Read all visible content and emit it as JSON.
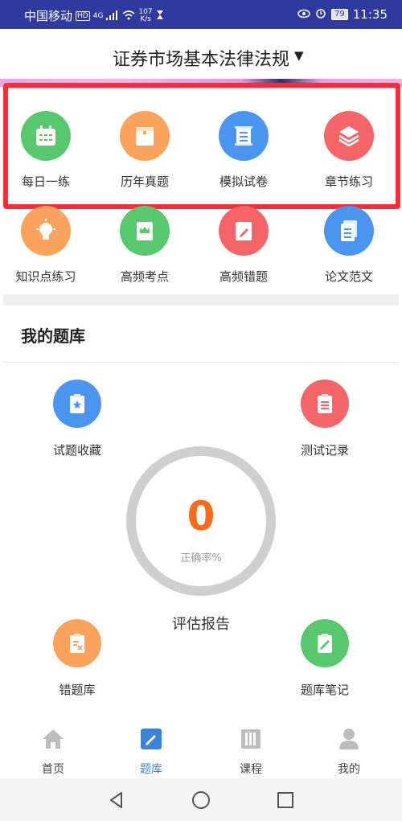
{
  "status_bar": {
    "carrier": "中国移动",
    "hd": "HD",
    "network": "4G",
    "speed_value": "107",
    "speed_unit": "K/s",
    "battery": "79",
    "time": "11:35"
  },
  "header": {
    "title": "证券市场基本法律法规",
    "caret": "▼"
  },
  "grid_row1": [
    {
      "label": "每日一练",
      "icon": "calendar-icon",
      "color": "#57c86c"
    },
    {
      "label": "历年真题",
      "icon": "box-icon",
      "color": "#fba25c"
    },
    {
      "label": "模拟试卷",
      "icon": "scroll-icon",
      "color": "#4a95f0"
    },
    {
      "label": "章节练习",
      "icon": "layers-icon",
      "color": "#f56567"
    }
  ],
  "grid_row2": [
    {
      "label": "知识点练习",
      "icon": "lightbulb-icon",
      "color": "#fba25c"
    },
    {
      "label": "高频考点",
      "icon": "crown-book-icon",
      "color": "#57c86c"
    },
    {
      "label": "高频错题",
      "icon": "edit-book-icon",
      "color": "#f56567"
    },
    {
      "label": "论文范文",
      "icon": "document-icon",
      "color": "#4a95f0"
    }
  ],
  "my_bank": {
    "title": "我的题库",
    "favorites": "试题收藏",
    "test_records": "测试记录",
    "wrong_bank": "错题库",
    "notes": "题库笔记",
    "accuracy_value": "0",
    "accuracy_label": "正确率%",
    "report": "评估报告"
  },
  "bottom_nav": [
    {
      "label": "首页",
      "icon": "home-icon",
      "active": false
    },
    {
      "label": "题库",
      "icon": "edit-icon",
      "active": true
    },
    {
      "label": "课程",
      "icon": "books-icon",
      "active": false
    },
    {
      "label": "我的",
      "icon": "user-icon",
      "active": false
    }
  ],
  "colors": {
    "status_bar": "#2f3a9e",
    "highlight": "#ff2a38",
    "accent_orange": "#ff6a1a",
    "active_tab": "#3a84d8"
  }
}
